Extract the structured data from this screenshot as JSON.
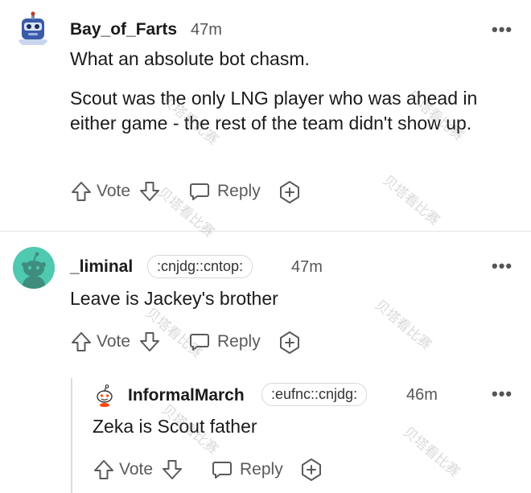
{
  "comments": [
    {
      "username": "Bay_of_Farts",
      "time": "47m",
      "paragraphs": [
        "What an absolute bot chasm.",
        "Scout was the only LNG player who was ahead in either game - the rest of the team didn't show up."
      ],
      "vote_label": "Vote",
      "reply_label": "Reply",
      "avatar_icon": "robot-avatar-icon"
    },
    {
      "username": "_liminal",
      "flair": ":cnjdg::cntop:",
      "time": "47m",
      "paragraphs": [
        "Leave is Jackey's brother"
      ],
      "vote_label": "Vote",
      "reply_label": "Reply",
      "avatar_icon": "snoo-avatar-icon",
      "avatar_color": "#4fc9b0"
    },
    {
      "username": "InformalMarch",
      "flair": ":eufnc::cnjdg:",
      "time": "46m",
      "paragraphs": [
        "Zeka is Scout father"
      ],
      "vote_label": "Vote",
      "reply_label": "Reply",
      "avatar_icon": "snoo-avatar-icon"
    }
  ],
  "more_icon_text": "•••",
  "watermark_text": "贝塔看比赛"
}
